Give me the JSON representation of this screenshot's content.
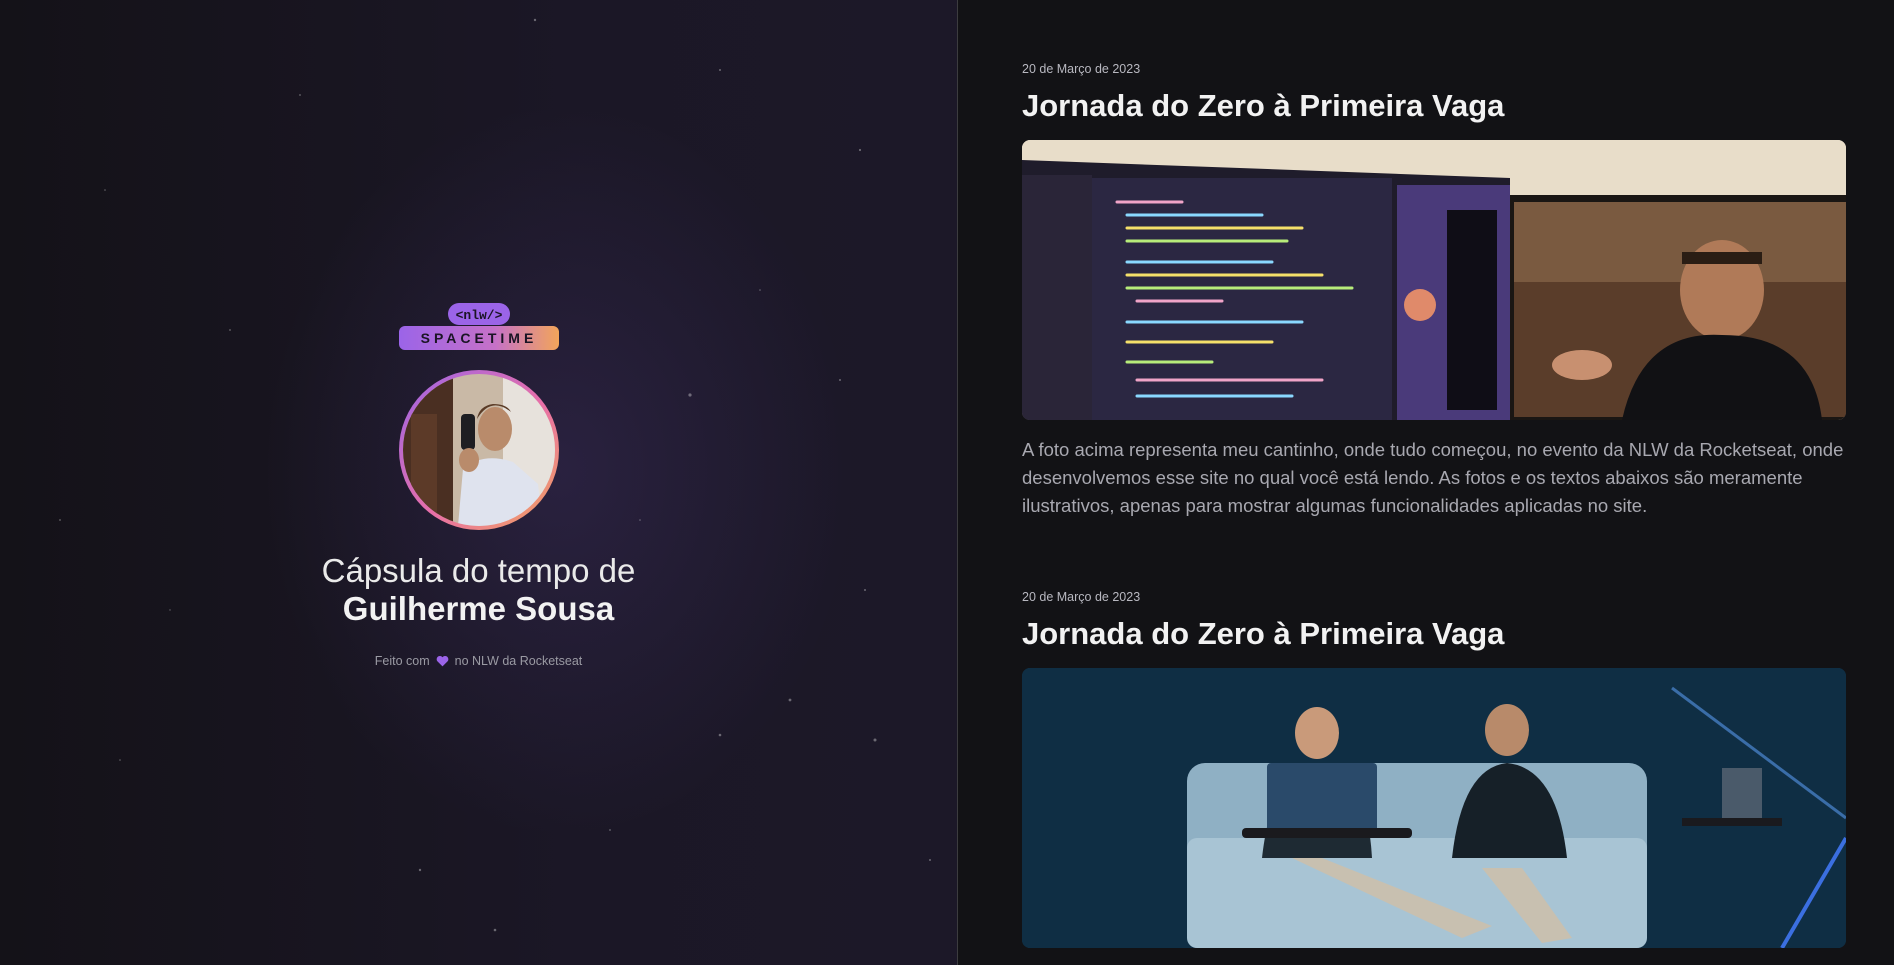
{
  "profile": {
    "logo_top": "<nlw/>",
    "logo_bottom": "SPACETIME",
    "title_line1": "Cápsula do tempo de",
    "title_line2": "Guilherme Sousa",
    "footer_prefix": "Feito com",
    "footer_suffix": "no NLW da Rocketseat",
    "footer_icon": "heart-icon"
  },
  "colors": {
    "accent_purple": "#9b64e8",
    "accent_orange": "#f2a55a",
    "background": "#121215"
  },
  "posts": [
    {
      "date": "20 de Março de 2023",
      "title": "Jornada do Zero à Primeira Vaga",
      "image": "desk-setup-photo",
      "text": "A foto acima representa meu cantinho, onde tudo começou, no evento da NLW da Rocketseat, onde desenvolvemos esse site no qual você está lendo. As fotos e os textos abaixos são meramente ilustrativos, apenas para mostrar algumas funcionalidades aplicadas no site."
    },
    {
      "date": "20 de Março de 2023",
      "title": "Jornada do Zero à Primeira Vaga",
      "image": "stage-photo"
    }
  ]
}
